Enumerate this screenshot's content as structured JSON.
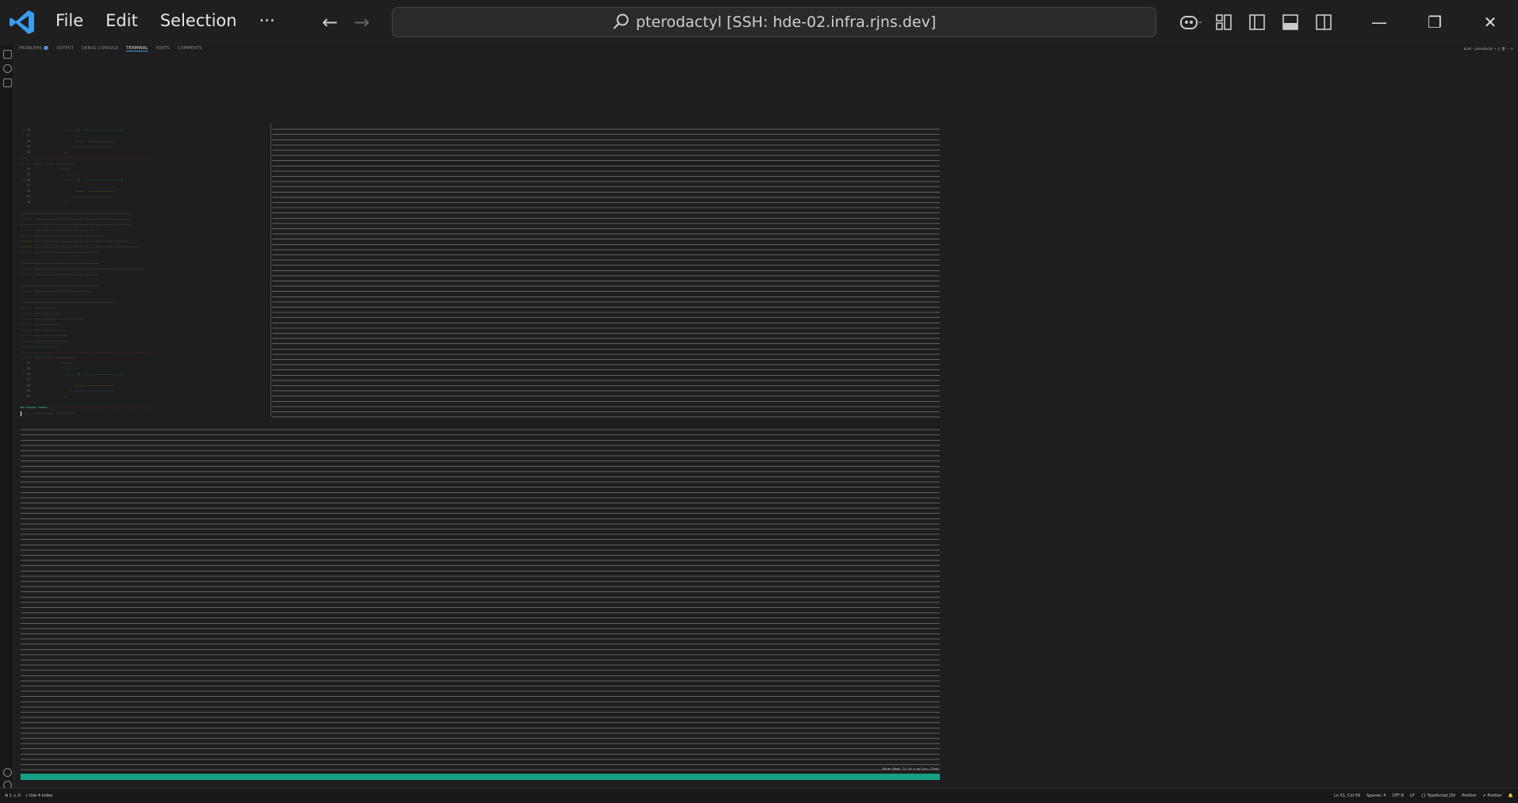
{
  "titlebar": {
    "menu": [
      "File",
      "Edit",
      "Selection",
      "···"
    ],
    "search_text": "pterodactyl [SSH: hde-02.infra.rjns.dev]"
  },
  "panel": {
    "tabs": [
      "PROBLEMS",
      "OUTPUT",
      "DEBUG CONSOLE",
      "TERMINAL",
      "PORTS",
      "COMMENTS"
    ],
    "problems_count": "7",
    "active_tab": "TERMINAL",
    "right_info": "bash - pterodactyl"
  },
  "terminal": {
    "end_text": "No Issues found.",
    "status_info": "Qulae Mood: Ir le a nullar: Clent"
  },
  "statusbar": {
    "left": [
      "⊗ 1 ⚠ 0",
      "⚡ Use 4 index"
    ],
    "right": [
      "Ln 51, Col 59",
      "Spaces: 4",
      "UTF-8",
      "LF",
      "{} TypeScript JSX",
      "Prettier",
      "✔ Prettier"
    ]
  }
}
